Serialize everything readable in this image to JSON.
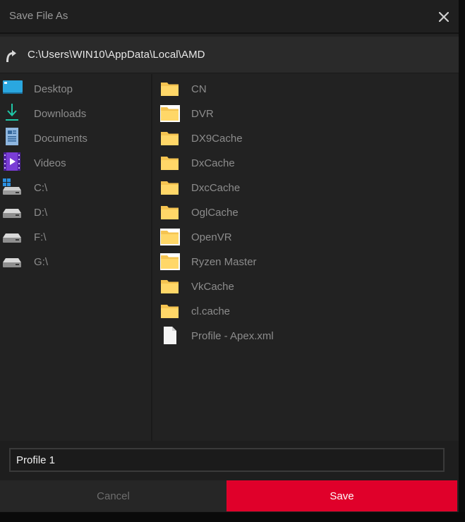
{
  "dialog": {
    "title": "Save File As",
    "path": "C:\\Users\\WIN10\\AppData\\Local\\AMD"
  },
  "sidebar": {
    "items": [
      {
        "label": "Desktop",
        "icon": "desktop-icon"
      },
      {
        "label": "Downloads",
        "icon": "download-icon"
      },
      {
        "label": "Documents",
        "icon": "documents-icon"
      },
      {
        "label": "Videos",
        "icon": "videos-icon"
      },
      {
        "label": "C:\\",
        "icon": "system-drive-icon"
      },
      {
        "label": "D:\\",
        "icon": "drive-icon"
      },
      {
        "label": "F:\\",
        "icon": "drive-icon"
      },
      {
        "label": "G:\\",
        "icon": "drive-icon"
      }
    ]
  },
  "files": {
    "items": [
      {
        "label": "CN",
        "icon": "folder-icon"
      },
      {
        "label": "DVR",
        "icon": "folder-icon"
      },
      {
        "label": "DX9Cache",
        "icon": "folder-icon"
      },
      {
        "label": "DxCache",
        "icon": "folder-icon"
      },
      {
        "label": "DxcCache",
        "icon": "folder-icon"
      },
      {
        "label": "OglCache",
        "icon": "folder-icon"
      },
      {
        "label": "OpenVR",
        "icon": "folder-icon"
      },
      {
        "label": "Ryzen Master",
        "icon": "folder-icon"
      },
      {
        "label": "VkCache",
        "icon": "folder-icon"
      },
      {
        "label": "cl.cache",
        "icon": "folder-icon"
      },
      {
        "label": "Profile - Apex.xml",
        "icon": "file-icon"
      }
    ]
  },
  "filename": {
    "value": "Profile 1"
  },
  "buttons": {
    "cancel": "Cancel",
    "save": "Save"
  },
  "colors": {
    "accent": "#e0002a",
    "folder": "#f5c451",
    "background": "#222222"
  }
}
